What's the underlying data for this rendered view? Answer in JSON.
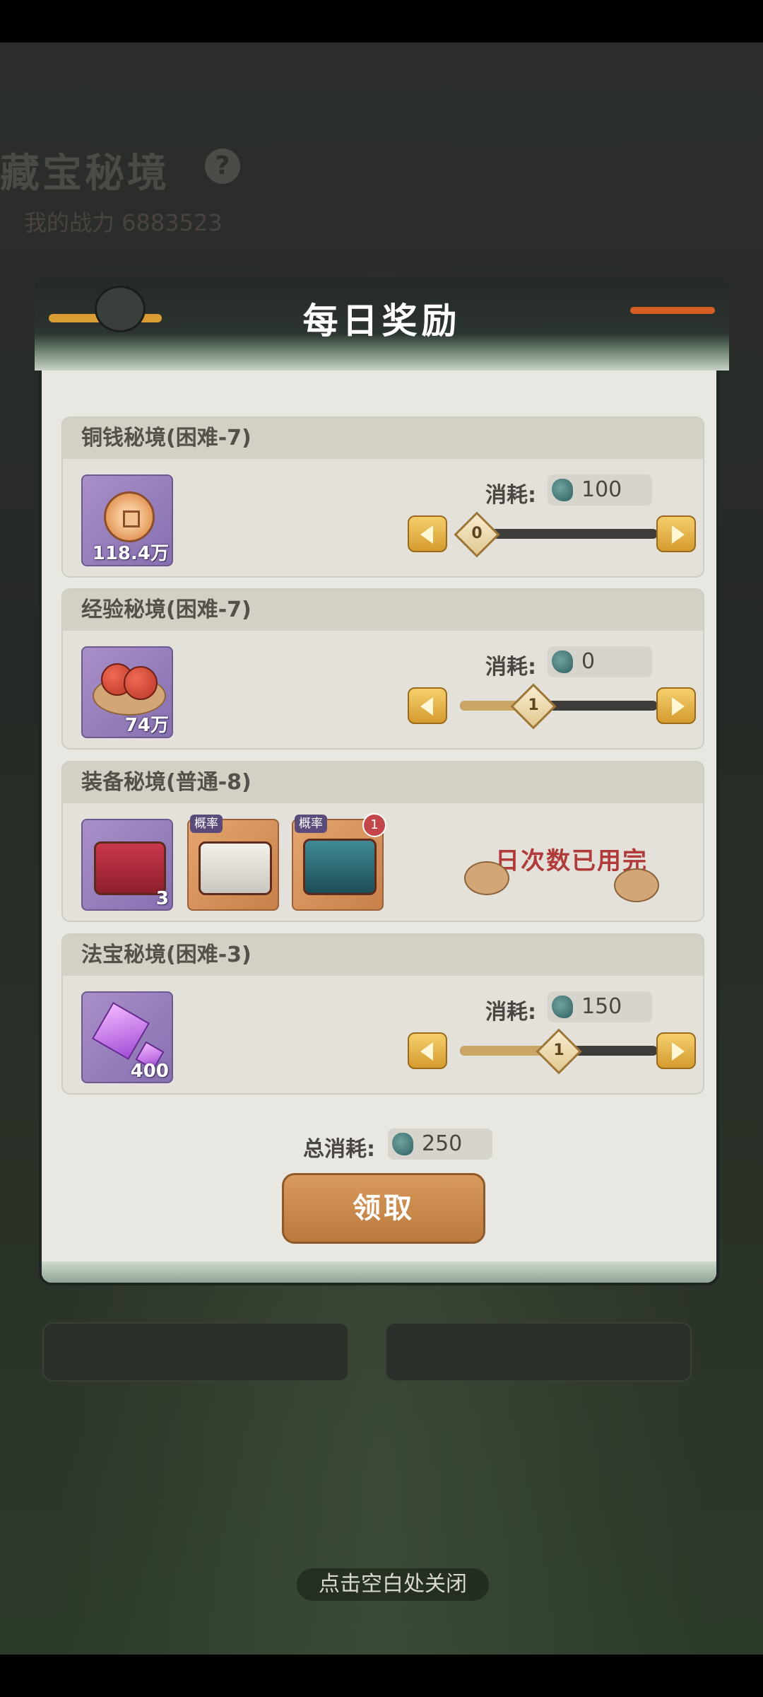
{
  "background": {
    "title": "藏宝秘境",
    "help_icon": "question-icon",
    "help_text": "?",
    "power": "我的战力 6883523"
  },
  "dialog": {
    "title": "每日奖励",
    "sections": [
      {
        "name": "铜钱秘境(困难-7)",
        "item": {
          "icon": "copper-coin-icon",
          "count": "118.4万"
        },
        "cost_label": "消耗:",
        "cost": "100",
        "slider_value": "0"
      },
      {
        "name": "经验秘境(困难-7)",
        "item": {
          "icon": "exp-gourd-icon",
          "count": "74万"
        },
        "cost_label": "消耗:",
        "cost": "0",
        "slider_value": "1"
      },
      {
        "name": "装备秘境(普通-8)",
        "items": [
          {
            "icon": "red-chest-icon",
            "count": "3"
          },
          {
            "icon": "white-chest-icon",
            "badge": "概率"
          },
          {
            "icon": "blue-chest-icon",
            "badge": "概率",
            "count_badge": "1"
          }
        ],
        "status": "日次数已用完"
      },
      {
        "name": "法宝秘境(困难-3)",
        "item": {
          "icon": "purple-crystal-icon",
          "count": "400"
        },
        "cost_label": "消耗:",
        "cost": "150",
        "slider_value": "1"
      }
    ],
    "total_label": "总消耗:",
    "total": "250",
    "claim_button": "领取"
  },
  "close_hint": "点击空白处关闭",
  "colors": {
    "accent_gold": "#d69b2f",
    "claim_button": "#c5864a",
    "status_red": "#b13a3a",
    "item_purple": "#8670b1"
  }
}
